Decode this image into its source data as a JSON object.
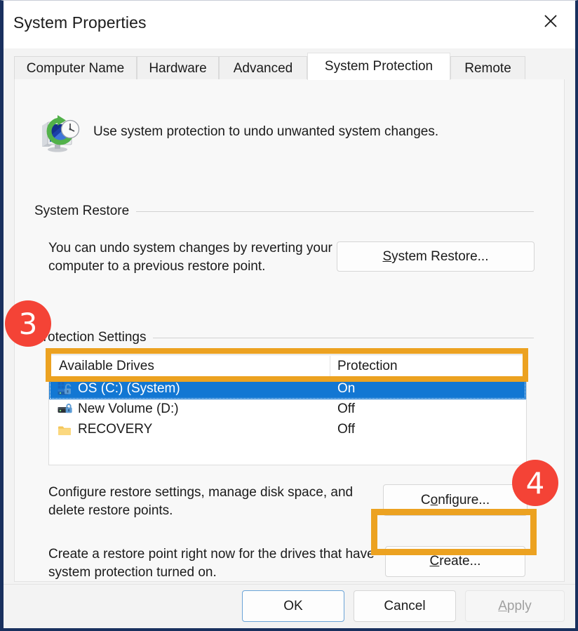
{
  "window": {
    "title": "System Properties",
    "close_icon": "close-icon"
  },
  "tabs": [
    {
      "label": "Computer Name",
      "selected": false
    },
    {
      "label": "Hardware",
      "selected": false
    },
    {
      "label": "Advanced",
      "selected": false
    },
    {
      "label": "System Protection",
      "selected": true
    },
    {
      "label": "Remote",
      "selected": false
    }
  ],
  "header": {
    "icon": "system-protection-monitor-icon",
    "text": "Use system protection to undo unwanted system changes."
  },
  "system_restore": {
    "group_label": "System Restore",
    "description": "You can undo system changes by reverting your computer to a previous restore point.",
    "button": {
      "accel": "S",
      "rest": "ystem Restore..."
    }
  },
  "protection_settings": {
    "group_label": "Protection Settings",
    "columns": {
      "drives": "Available Drives",
      "protection": "Protection"
    },
    "rows": [
      {
        "name": "OS (C:) (System)",
        "protection": "On",
        "icon": "drive-windows-unlocked-icon",
        "selected": true
      },
      {
        "name": "New Volume (D:)",
        "protection": "Off",
        "icon": "drive-locked-icon",
        "selected": false
      },
      {
        "name": "RECOVERY",
        "protection": "Off",
        "icon": "folder-icon",
        "selected": false
      }
    ],
    "configure": {
      "description": "Configure restore settings, manage disk space, and delete restore points.",
      "button": {
        "pre": "C",
        "accel": "o",
        "rest": "nfigure..."
      }
    },
    "create": {
      "description": "Create a restore point right now for the drives that have system protection turned on.",
      "button": {
        "accel": "C",
        "rest": "reate..."
      }
    }
  },
  "footer": {
    "ok": "OK",
    "cancel": "Cancel",
    "apply": {
      "accel": "A",
      "rest": "pply"
    }
  },
  "annotations": {
    "badges": [
      {
        "number": "3",
        "color": "#f44336"
      },
      {
        "number": "4",
        "color": "#f44336"
      }
    ],
    "highlight_color": "#eca221"
  },
  "colors": {
    "selection_blue": "#1277d3",
    "highlight_orange": "#eca221",
    "badge_red": "#f44336",
    "window_border": "#19305e"
  }
}
